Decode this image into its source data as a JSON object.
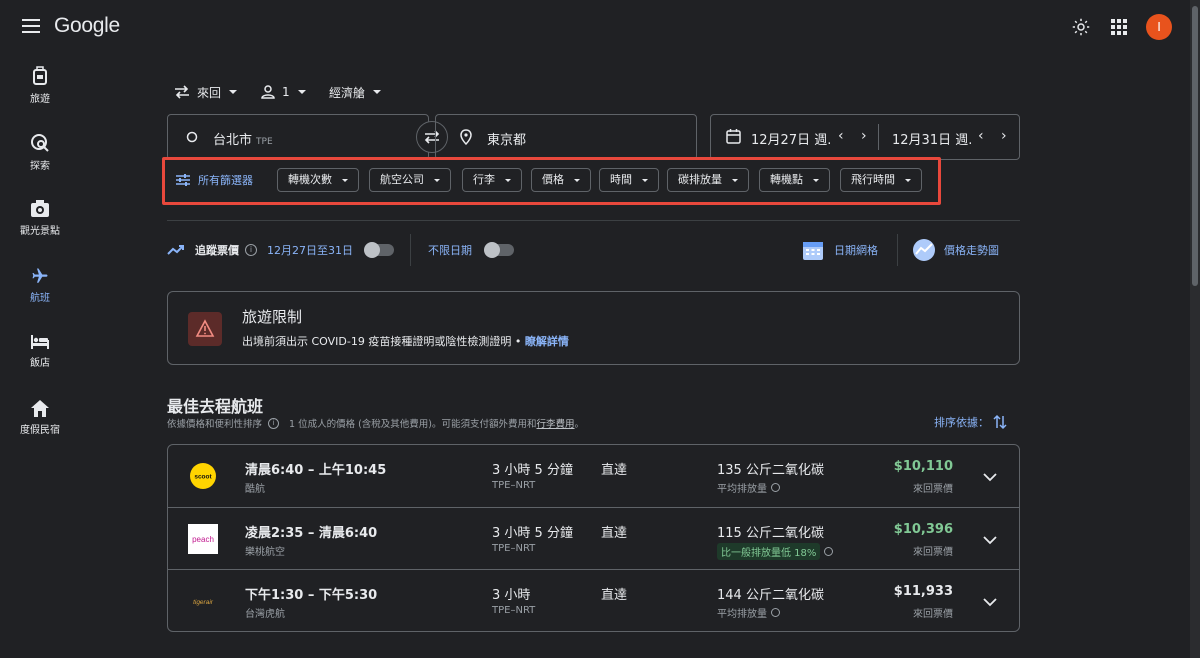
{
  "header": {
    "logo": "Google",
    "avatar_letter": "I",
    "avatar_color": "#e8531d"
  },
  "sidebar": {
    "items": [
      {
        "label": "旅遊",
        "icon": "luggage-icon"
      },
      {
        "label": "探索",
        "icon": "explore-icon"
      },
      {
        "label": "觀光景點",
        "icon": "camera-icon"
      },
      {
        "label": "航班",
        "icon": "airplane-icon",
        "active": true
      },
      {
        "label": "飯店",
        "icon": "bed-icon"
      },
      {
        "label": "度假民宿",
        "icon": "home-icon"
      }
    ]
  },
  "search": {
    "trip_type": "來回",
    "passengers": "1",
    "cabin_class": "經濟艙",
    "origin": "台北市",
    "origin_code": "TPE",
    "destination": "東京都",
    "depart_date": "12月27日 週.",
    "return_date": "12月31日 週."
  },
  "filters": {
    "all_filters": "所有篩選器",
    "chips": [
      "轉機次數",
      "航空公司",
      "行李",
      "價格",
      "時間",
      "碳排放量",
      "轉機點",
      "飛行時間"
    ]
  },
  "tracking": {
    "track_label": "追蹤票價",
    "track_range": "12月27日至31日",
    "any_dates": "不限日期",
    "date_grid": "日期網格",
    "price_graph": "價格走勢圖"
  },
  "advisory": {
    "title": "旅遊限制",
    "body": "出境前須出示 COVID-19 疫苗接種證明或陰性檢測證明 •",
    "link": "瞭解詳情"
  },
  "results": {
    "title": "最佳去程航班",
    "subtitle_a": "依據價格和便利性排序",
    "subtitle_b": "1 位成人的價格 (含稅及其他費用)。可能須支付額外費用和",
    "subtitle_link": "行李費用",
    "subtitle_end": "。",
    "sort_label": "排序依據：",
    "flights": [
      {
        "logo_text": "scoot",
        "times": "清晨6:40 – 上午10:45",
        "airline": "酷航",
        "duration": "3 小時 5 分鐘",
        "route": "TPE–NRT",
        "stops": "直達",
        "emissions": "135 公斤二氧化碳",
        "emissions_note": "平均排放量",
        "price": "$10,110",
        "price_color": "#81c995",
        "price_note": "來回票價"
      },
      {
        "logo_text": "peach",
        "times": "凌晨2:35 – 清晨6:40",
        "airline": "樂桃航空",
        "duration": "3 小時 5 分鐘",
        "route": "TPE–NRT",
        "stops": "直達",
        "emissions": "115 公斤二氧化碳",
        "emissions_note": "比一般排放量低 18%",
        "price": "$10,396",
        "price_color": "#81c995",
        "price_note": "來回票價"
      },
      {
        "logo_text": "tigerair",
        "times": "下午1:30 – 下午5:30",
        "airline": "台灣虎航",
        "duration": "3 小時",
        "route": "TPE–NRT",
        "stops": "直達",
        "emissions": "144 公斤二氧化碳",
        "emissions_note": "平均排放量",
        "price": "$11,933",
        "price_color": "#e8eaed",
        "price_note": "來回票價"
      }
    ]
  }
}
